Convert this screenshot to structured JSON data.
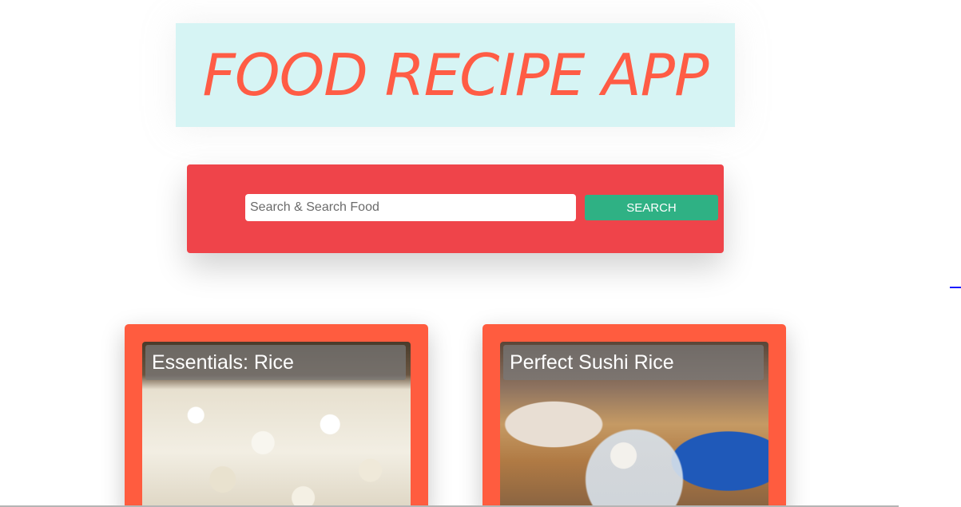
{
  "header": {
    "title": "FOOD RECIPE APP"
  },
  "search": {
    "placeholder": "Search & Search Food",
    "value": "",
    "button_label": "SEARCH"
  },
  "recipes": [
    {
      "title": "Essentials: Rice",
      "image": "rice-photo"
    },
    {
      "title": "Perfect Sushi Rice",
      "image": "sushi-rice-photo"
    }
  ],
  "colors": {
    "title_text": "#ff5c45",
    "title_background": "#d6f4f4",
    "search_panel": "#ef444a",
    "search_button": "#2fb184",
    "card_background": "#ff5c3f"
  }
}
